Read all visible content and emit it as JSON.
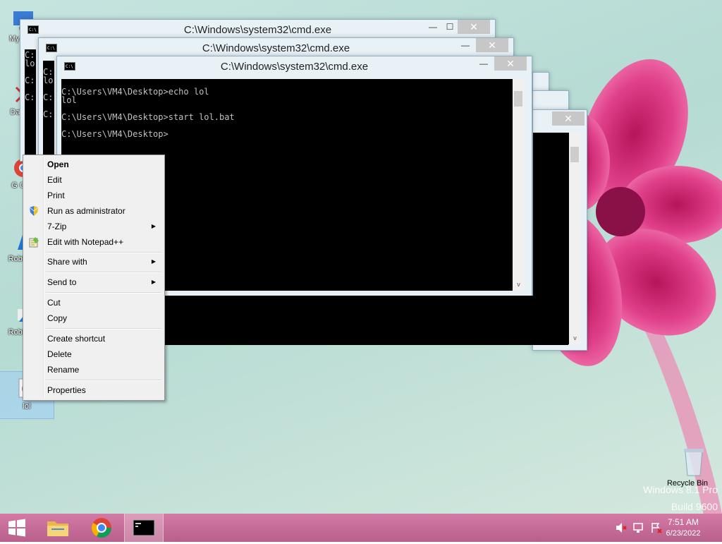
{
  "desktop": {
    "icons": [
      {
        "label": "My C"
      },
      {
        "label": "Data"
      },
      {
        "label": "G\nC"
      },
      {
        "label": "Roblo"
      },
      {
        "label": "Roblo"
      },
      {
        "label": "lol"
      }
    ],
    "recycle_bin": "Recycle Bin",
    "watermark": {
      "line1": "Windows 8.1 Pro",
      "line2": "Build 9600"
    }
  },
  "windows": [
    {
      "title": "C:\\Windows\\system32\\cmd.exe",
      "console_lines": [
        "C:",
        "lo",
        "",
        "C:",
        "",
        "C:"
      ]
    },
    {
      "title": "C:\\Windows\\system32\\cmd.exe",
      "console_lines": [
        "C:",
        "lo",
        "",
        "C:",
        "",
        "C:"
      ]
    },
    {
      "title": "C:\\Windows\\system32\\cmd.exe",
      "console_lines": [
        "C:\\Users\\VM4\\Desktop>echo lol",
        "lol",
        "",
        "C:\\Users\\VM4\\Desktop>start lol.bat",
        "",
        "C:\\Users\\VM4\\Desktop>"
      ]
    }
  ],
  "window_controls": {
    "minimize": "—",
    "maximize": "☐",
    "close": "✕"
  },
  "context_menu": {
    "items": {
      "open": "Open",
      "edit": "Edit",
      "print": "Print",
      "run_as_admin": "Run as administrator",
      "seven_zip": "7-Zip",
      "edit_notepadpp": "Edit with Notepad++",
      "share_with": "Share with",
      "send_to": "Send to",
      "cut": "Cut",
      "copy": "Copy",
      "create_shortcut": "Create shortcut",
      "delete": "Delete",
      "rename": "Rename",
      "properties": "Properties"
    },
    "submenu_arrow": "▶"
  },
  "taskbar": {
    "time": "7:51 AM",
    "date": "6/23/2022"
  },
  "colors": {
    "taskbar": "#c36b97",
    "console_bg": "#000000",
    "close_button": "#c7c7c7"
  }
}
